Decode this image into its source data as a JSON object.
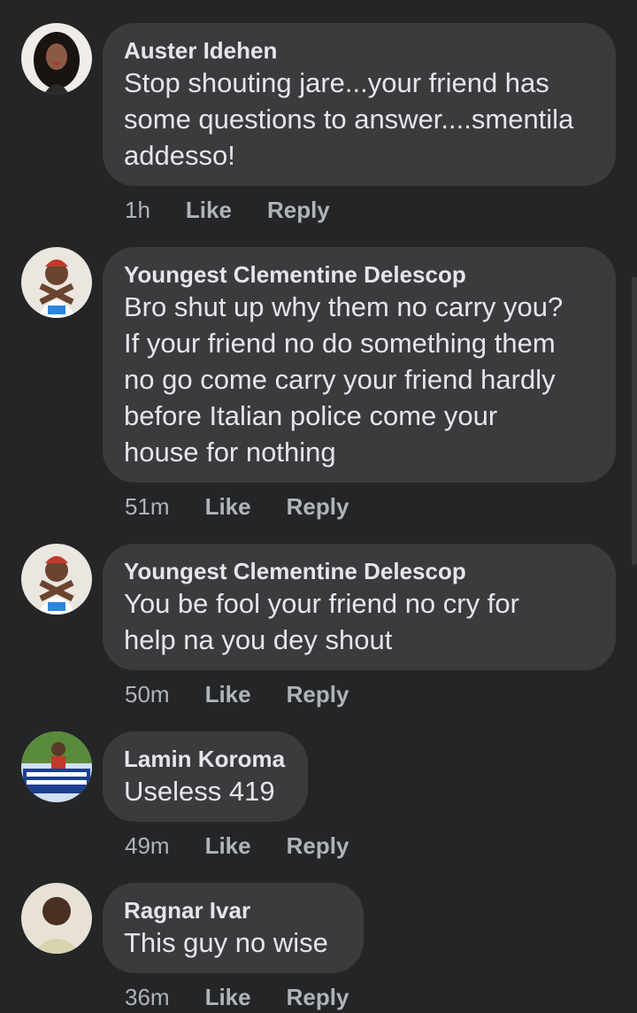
{
  "comments": [
    {
      "author": "Auster Idehen",
      "text": "Stop shouting jare...your friend has\nsome questions to answer....smentila\naddesso!",
      "time": "1h",
      "like": "Like",
      "reply": "Reply"
    },
    {
      "author": "Youngest Clementine Delescop",
      "text": "Bro shut up why them no carry you?\nIf your friend no do something them\nno go come carry your friend hardly\nbefore Italian police come your\nhouse for nothing",
      "time": "51m",
      "like": "Like",
      "reply": "Reply"
    },
    {
      "author": "Youngest Clementine Delescop",
      "text": "You be fool your friend no cry for\nhelp na you dey shout",
      "time": "50m",
      "like": "Like",
      "reply": "Reply"
    },
    {
      "author": "Lamin Koroma",
      "text": "Useless 419",
      "time": "49m",
      "like": "Like",
      "reply": "Reply"
    },
    {
      "author": "Ragnar Ivar",
      "text": "This guy no wise",
      "time": "36m",
      "like": "Like",
      "reply": "Reply"
    }
  ]
}
